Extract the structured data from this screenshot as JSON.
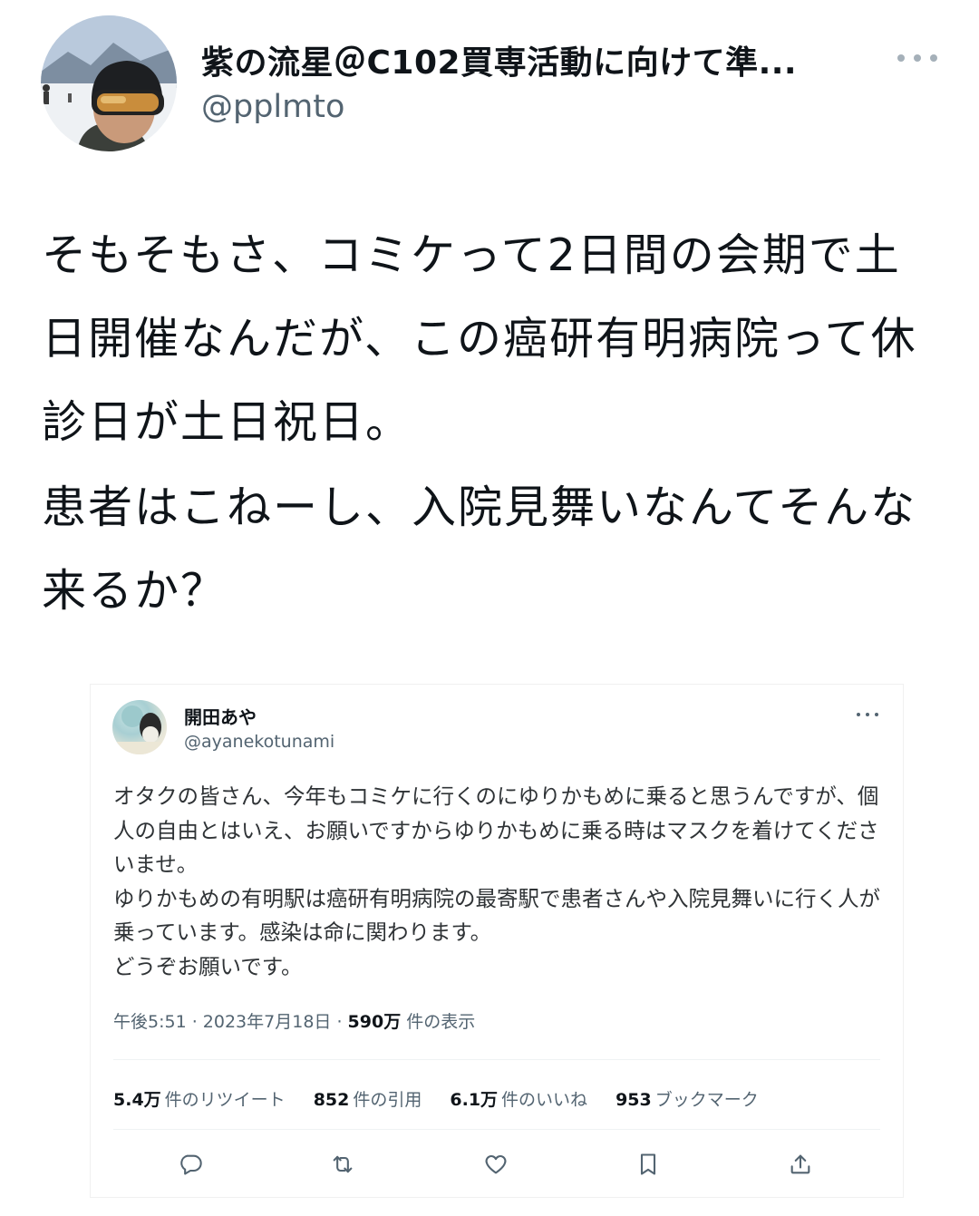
{
  "author": {
    "display_name": "紫の流星＠C102買専活動に向けて準...",
    "handle": "@pplmto"
  },
  "tweet": {
    "paragraph_1": "そもそもさ、コミケって2日間の会期で土日開催なんだが、この癌研有明病院って休診日が土日祝日。",
    "paragraph_2": "患者はこねーし、入院見舞いなんてそんな来るか？"
  },
  "quoted": {
    "display_name": "開田あや",
    "handle": "@ayanekotunami",
    "body": "オタクの皆さん、今年もコミケに行くのにゆりかもめに乗ると思うんですが、個人の自由とはいえ、お願いですからゆりかもめに乗る時はマスクを着けてくださいませ。\nゆりかもめの有明駅は癌研有明病院の最寄駅で患者さんや入院見舞いに行く人が乗っています。感染は命に関わります。\nどうぞお願いです。",
    "time": "午後5:51 · 2023年7月18日 · ",
    "views_count": "590万",
    "views_label": " 件の表示",
    "stats": {
      "retweets_count": "5.4万",
      "retweets_label": "件のリツイート",
      "quotes_count": "852",
      "quotes_label": "件の引用",
      "likes_count": "6.1万",
      "likes_label": "件のいいね",
      "bookmarks_count": "953",
      "bookmarks_label": "ブックマーク"
    },
    "action_icons": [
      "reply-icon",
      "retweet-icon",
      "like-icon",
      "bookmark-icon",
      "share-icon"
    ]
  },
  "colors": {
    "text": "#0f1419",
    "secondary": "#536471",
    "divider": "#eff3f4"
  }
}
